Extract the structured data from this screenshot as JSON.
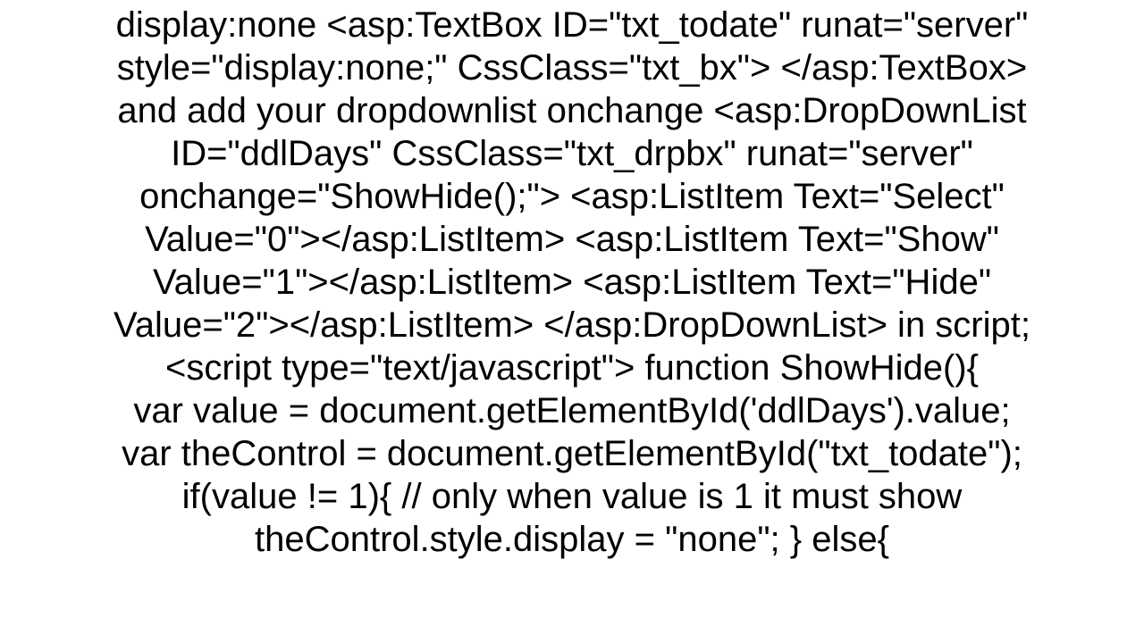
{
  "lines": {
    "l1": "display:none   <asp:TextBox ID=\"txt_todate\" runat=\"server\"",
    "l2": "style=\"display:none;\" CssClass=\"txt_bx\">   </asp:TextBox>",
    "l3": "and add your dropdownlist  onchange  <asp:DropDownList",
    "l4": "ID=\"ddlDays\" CssClass=\"txt_drpbx\" runat=\"server\"",
    "l5": "onchange=\"ShowHide();\">    <asp:ListItem Text=\"Select\"",
    "l6": "Value=\"0\"></asp:ListItem>    <asp:ListItem Text=\"Show\"",
    "l7": "Value=\"1\"></asp:ListItem>    <asp:ListItem Text=\"Hide\"",
    "l8": "Value=\"2\"></asp:ListItem>  </asp:DropDownList>  in script;",
    "l9": "<script  type=\"text/javascript\">    function ShowHide(){",
    "l10": "var value = document.getElementById('ddlDays').value;",
    "l11": "var theControl = document.getElementById(\"txt_todate\");",
    "l12": "if(value != 1){  // only when value is 1 it must show",
    "l13": "theControl.style.display = \"none\";      }     else{"
  }
}
